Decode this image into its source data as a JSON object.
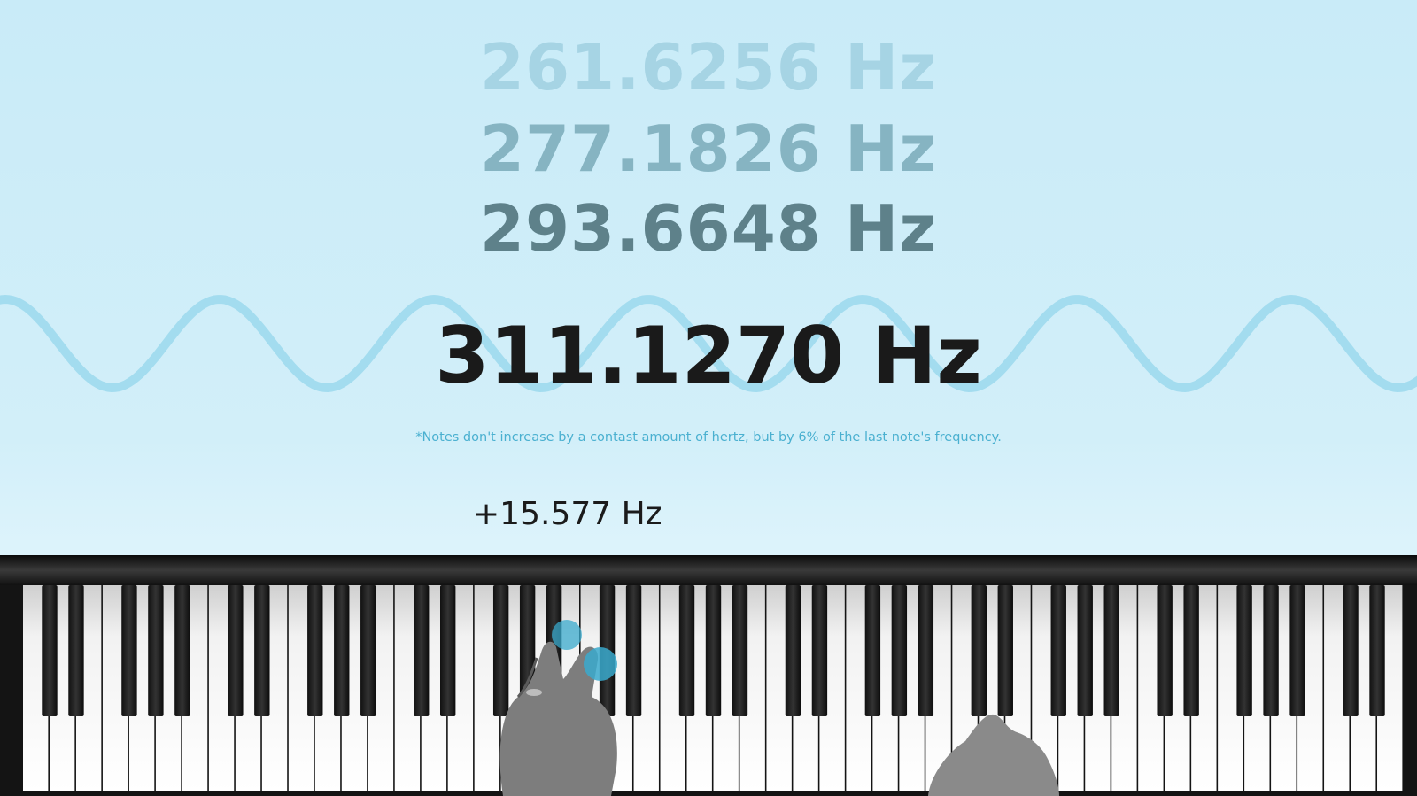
{
  "frequencies": {
    "f1": "261.6256 Hz",
    "f2": "277.1826 Hz",
    "f3": "293.6648 Hz",
    "current": "311.1270 Hz"
  },
  "footnote": "*Notes don't increase by a contast amount of hertz, but by 6% of the last note's frequency.",
  "increment": "+15.577 Hz",
  "colors": {
    "background": "#cdecf8",
    "wave": "#a3dcef",
    "f1": "#a6d4e4",
    "f2": "#86b4c2",
    "f3": "#5e818a",
    "current": "#1a1a1a",
    "footnote": "#4ab0d0",
    "marker": "#3aa9cc"
  },
  "icons": [
    "sine-wave",
    "piano-keyboard",
    "finger-marker"
  ]
}
